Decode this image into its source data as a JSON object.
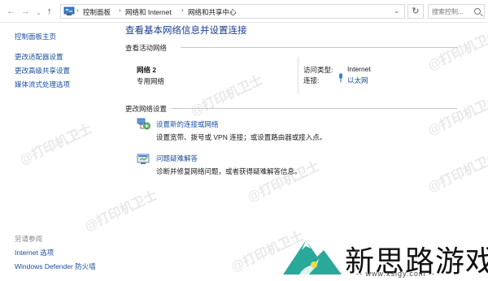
{
  "address_bar": {
    "back_icon": "arrow-left-icon",
    "forward_icon": "arrow-right-icon",
    "recent_icon": "chevron-down-icon",
    "up_icon": "arrow-up-icon",
    "breadcrumbs": [
      "控制面板",
      "网络和 Internet",
      "网络和共享中心"
    ],
    "search_placeholder": "搜索控制..."
  },
  "sidebar": {
    "items": [
      "控制面板主页",
      "更改适配器设置",
      "更改高级共享设置",
      "媒体流式处理选项"
    ],
    "see_also_header": "另请参阅",
    "see_also": [
      "Internet 选项",
      "Windows Defender 防火墙"
    ]
  },
  "main": {
    "title": "查看基本网络信息并设置连接",
    "active_networks_label": "查看活动网络",
    "network_name": "网络 2",
    "network_type": "专用网络",
    "access_type_label": "访问类型:",
    "access_type_value": "Internet",
    "connections_label": "连接:",
    "connections_value": "以太网",
    "change_settings_label": "更改网络设置",
    "setup_link": "设置新的连接或网络",
    "setup_desc": "设置宽带、拨号或 VPN 连接；或设置路由器或接入点。",
    "troubleshoot_link": "问题疑难解答",
    "troubleshoot_desc": "诊断并修复网络问题，或者获得疑难解答信息。"
  },
  "watermark": "@打印机卫士",
  "logo": {
    "text": "新思路游戏",
    "url": "-- www.xslgy.com --"
  },
  "colors": {
    "link": "#1a4e9e",
    "title": "#1a3f8f",
    "logo_teal": "#2aa89a"
  }
}
